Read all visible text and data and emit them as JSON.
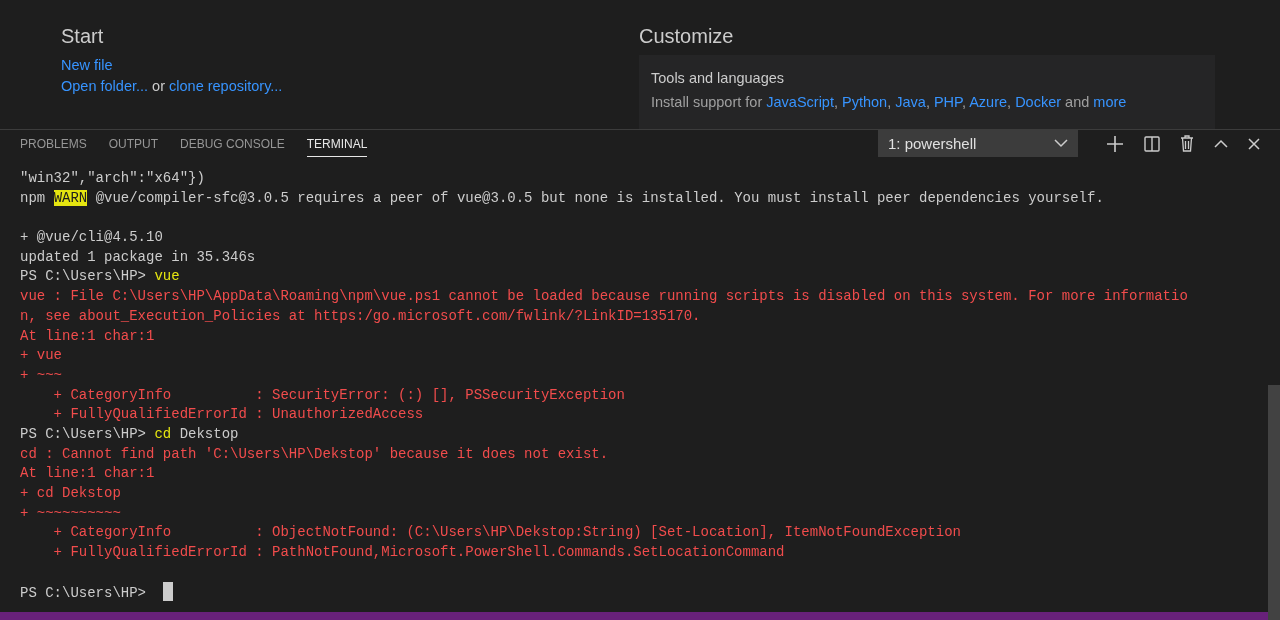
{
  "welcome": {
    "start": {
      "title": "Start",
      "actions": [
        {
          "segments": [
            {
              "kind": "link",
              "text": "New file"
            }
          ]
        },
        {
          "segments": [
            {
              "kind": "link",
              "text": "Open folder..."
            },
            {
              "kind": "text",
              "text": "or"
            },
            {
              "kind": "link",
              "text": "clone repository..."
            }
          ]
        }
      ]
    },
    "customize": {
      "title": "Customize",
      "card": {
        "title": "Tools and languages",
        "segments": [
          {
            "kind": "text",
            "text": "Install support for"
          },
          {
            "kind": "link",
            "text": "JavaScript"
          },
          {
            "kind": "text",
            "text": ","
          },
          {
            "kind": "link",
            "text": "Python"
          },
          {
            "kind": "text",
            "text": ","
          },
          {
            "kind": "link",
            "text": "Java"
          },
          {
            "kind": "text",
            "text": ","
          },
          {
            "kind": "link",
            "text": "PHP"
          },
          {
            "kind": "text",
            "text": ","
          },
          {
            "kind": "link",
            "text": "Azure"
          },
          {
            "kind": "text",
            "text": ","
          },
          {
            "kind": "link",
            "text": "Docker"
          },
          {
            "kind": "text",
            "text": "and"
          },
          {
            "kind": "link",
            "text": "more"
          }
        ]
      }
    }
  },
  "panel": {
    "tabs": [
      {
        "label": "PROBLEMS",
        "selected": false
      },
      {
        "label": "OUTPUT",
        "selected": false
      },
      {
        "label": "DEBUG CONSOLE",
        "selected": false
      },
      {
        "label": "TERMINAL",
        "selected": true
      }
    ],
    "terminal_select": {
      "value": "1: powershell"
    },
    "terminal": {
      "lines": [
        {
          "kind": "text",
          "segments": [
            {
              "kind": "out",
              "text": "\"win32\",\"arch\":\"x64\"})"
            }
          ]
        },
        {
          "kind": "text",
          "segments": [
            {
              "kind": "out",
              "text": "npm"
            },
            {
              "kind": "warn",
              "text": "WARN"
            },
            {
              "kind": "out",
              "text": "@vue/compiler-sfc@3.0.5 requires a peer of vue@3.0.5 but none is installed. You must install peer dependencies yourself."
            }
          ]
        },
        {
          "kind": "blank"
        },
        {
          "kind": "text",
          "segments": [
            {
              "kind": "out",
              "text": "+ @vue/cli@4.5.10"
            }
          ]
        },
        {
          "kind": "text",
          "segments": [
            {
              "kind": "out",
              "text": "updated 1 package in 35.346s"
            }
          ]
        },
        {
          "kind": "text",
          "segments": [
            {
              "kind": "out",
              "text": "PS C:\\Users\\HP>"
            },
            {
              "kind": "cmd",
              "text": "vue"
            }
          ]
        },
        {
          "kind": "text",
          "segments": [
            {
              "kind": "err",
              "text": "vue : File C:\\Users\\HP\\AppData\\Roaming\\npm\\vue.ps1 cannot be loaded because running scripts is disabled on this system. For more informatio"
            }
          ]
        },
        {
          "kind": "text",
          "segments": [
            {
              "kind": "err",
              "text": "n, see about_Execution_Policies at https:/go.microsoft.com/fwlink/?LinkID=135170."
            }
          ]
        },
        {
          "kind": "text",
          "segments": [
            {
              "kind": "err",
              "text": "At line:1 char:1"
            }
          ]
        },
        {
          "kind": "text",
          "segments": [
            {
              "kind": "err",
              "text": "+ vue"
            }
          ]
        },
        {
          "kind": "text",
          "segments": [
            {
              "kind": "err",
              "text": "+ ~~~"
            }
          ]
        },
        {
          "kind": "text",
          "segments": [
            {
              "kind": "err",
              "text": "    + CategoryInfo          : SecurityError: (:) [], PSSecurityException"
            }
          ]
        },
        {
          "kind": "text",
          "segments": [
            {
              "kind": "err",
              "text": "    + FullyQualifiedErrorId : UnauthorizedAccess"
            }
          ]
        },
        {
          "kind": "text",
          "segments": [
            {
              "kind": "out",
              "text": "PS C:\\Users\\HP>"
            },
            {
              "kind": "cmd",
              "text": "cd"
            },
            {
              "kind": "out",
              "text": "Dekstop"
            }
          ]
        },
        {
          "kind": "text",
          "segments": [
            {
              "kind": "err",
              "text": "cd : Cannot find path 'C:\\Users\\HP\\Dekstop' because it does not exist."
            }
          ]
        },
        {
          "kind": "text",
          "segments": [
            {
              "kind": "err",
              "text": "At line:1 char:1"
            }
          ]
        },
        {
          "kind": "text",
          "segments": [
            {
              "kind": "err",
              "text": "+ cd Dekstop"
            }
          ]
        },
        {
          "kind": "text",
          "segments": [
            {
              "kind": "err",
              "text": "+ ~~~~~~~~~~"
            }
          ]
        },
        {
          "kind": "text",
          "segments": [
            {
              "kind": "err",
              "text": "    + CategoryInfo          : ObjectNotFound: (C:\\Users\\HP\\Dekstop:String) [Set-Location], ItemNotFoundException"
            }
          ]
        },
        {
          "kind": "text",
          "segments": [
            {
              "kind": "err",
              "text": "    + FullyQualifiedErrorId : PathNotFound,Microsoft.PowerShell.Commands.SetLocationCommand"
            }
          ]
        },
        {
          "kind": "blank"
        },
        {
          "kind": "prompt",
          "segments": [
            {
              "kind": "out",
              "text": "PS C:\\Users\\HP>"
            }
          ]
        }
      ]
    }
  }
}
